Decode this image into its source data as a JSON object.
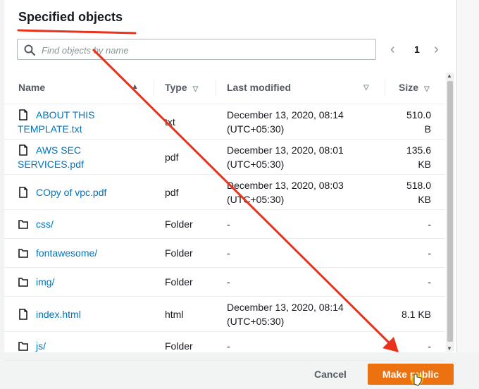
{
  "title": "Specified objects",
  "search": {
    "placeholder": "Find objects by name"
  },
  "pagination": {
    "prev": "‹",
    "page": "1",
    "next": "›"
  },
  "columns": {
    "name": "Name",
    "type": "Type",
    "last_modified": "Last modified",
    "size": "Size"
  },
  "rows": [
    {
      "name_line1": "ABOUT THIS",
      "name_line2": "TEMPLATE.txt",
      "type": "txt",
      "modified_line1": "December 13, 2020, 08:14",
      "modified_line2": "(UTC+05:30)",
      "size_line1": "510.0",
      "size_line2": "B",
      "icon": "file-icon"
    },
    {
      "name_line1": "AWS SEC",
      "name_line2": "SERVICES.pdf",
      "type": "pdf",
      "modified_line1": "December 13, 2020, 08:01",
      "modified_line2": "(UTC+05:30)",
      "size_line1": "135.6",
      "size_line2": "KB",
      "icon": "file-icon"
    },
    {
      "name_line1": "COpy of vpc.pdf",
      "name_line2": "",
      "type": "pdf",
      "modified_line1": "December 13, 2020, 08:03",
      "modified_line2": "(UTC+05:30)",
      "size_line1": "518.0",
      "size_line2": "KB",
      "icon": "file-icon"
    },
    {
      "name_line1": "css/",
      "name_line2": "",
      "type": "Folder",
      "modified_line1": "-",
      "modified_line2": "",
      "size_line1": "-",
      "size_line2": "",
      "icon": "folder-icon"
    },
    {
      "name_line1": "fontawesome/",
      "name_line2": "",
      "type": "Folder",
      "modified_line1": "-",
      "modified_line2": "",
      "size_line1": "-",
      "size_line2": "",
      "icon": "folder-icon"
    },
    {
      "name_line1": "img/",
      "name_line2": "",
      "type": "Folder",
      "modified_line1": "-",
      "modified_line2": "",
      "size_line1": "-",
      "size_line2": "",
      "icon": "folder-icon"
    },
    {
      "name_line1": "index.html",
      "name_line2": "",
      "type": "html",
      "modified_line1": "December 13, 2020, 08:14",
      "modified_line2": "(UTC+05:30)",
      "size_line1": "8.1 KB",
      "size_line2": "",
      "icon": "file-icon"
    },
    {
      "name_line1": "js/",
      "name_line2": "",
      "type": "Folder",
      "modified_line1": "-",
      "modified_line2": "",
      "size_line1": "-",
      "size_line2": "",
      "icon": "folder-icon"
    }
  ],
  "buttons": {
    "cancel": "Cancel",
    "make_public": "Make public"
  },
  "colors": {
    "primary": "#ec7211",
    "link": "#0073bb",
    "annotation": "#e8321c"
  }
}
